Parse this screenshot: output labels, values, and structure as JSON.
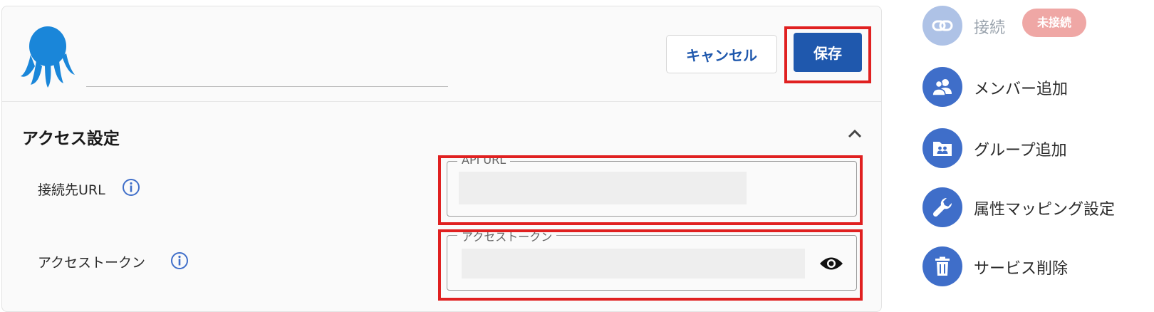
{
  "header": {
    "name_value": "",
    "cancel_label": "キャンセル",
    "save_label": "保存"
  },
  "section": {
    "title": "アクセス設定",
    "fields": [
      {
        "label": "接続先URL",
        "legend": "API URL",
        "value_masked": true
      },
      {
        "label": "アクセストークン",
        "legend": "アクセストークン",
        "value_masked": true
      }
    ]
  },
  "sidebar": {
    "items": [
      {
        "label": "接続",
        "icon": "link-icon",
        "enabled": false,
        "badge": "未接続"
      },
      {
        "label": "メンバー追加",
        "icon": "people-icon",
        "enabled": true
      },
      {
        "label": "グループ追加",
        "icon": "group-folder-icon",
        "enabled": true
      },
      {
        "label": "属性マッピング設定",
        "icon": "wrench-icon",
        "enabled": true
      },
      {
        "label": "サービス削除",
        "icon": "trash-icon",
        "enabled": true
      }
    ]
  },
  "colors": {
    "primary": "#1f58ad",
    "icon_bg": "#3f6ec9",
    "icon_bg_disabled": "#aec2e6",
    "badge_bg": "#efa7a5",
    "highlight_frame": "#e02020",
    "logo": "#1a86d9"
  }
}
